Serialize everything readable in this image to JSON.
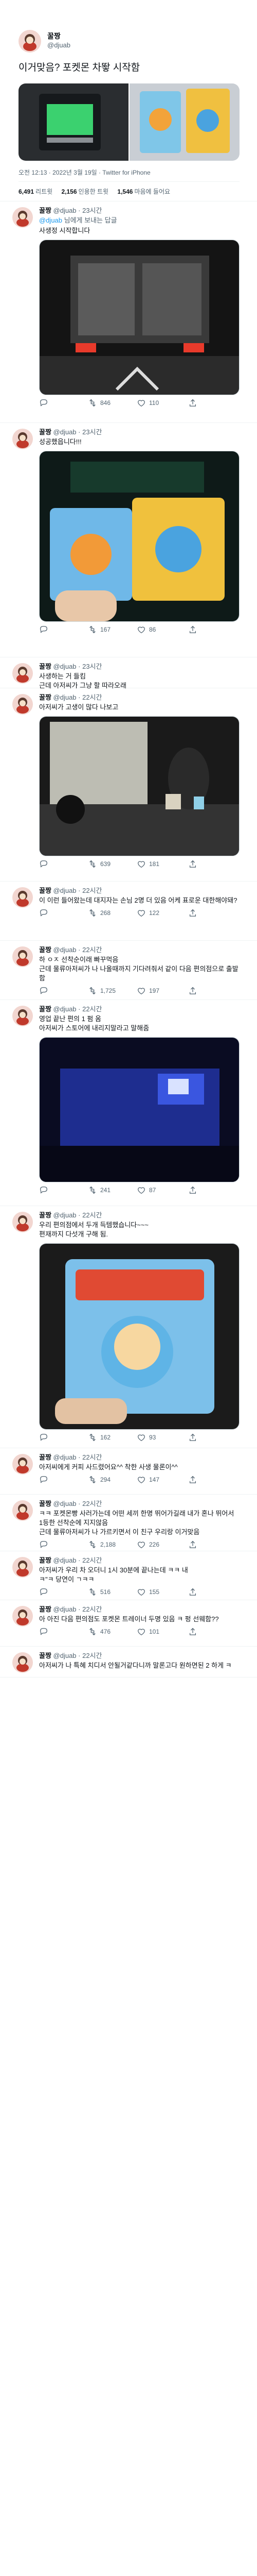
{
  "account": {
    "name": "꿀짱",
    "handle": "@djuab"
  },
  "reply_to": {
    "prefix": "",
    "mention": "@djuab",
    "suffix": " 님에게 보내는 답글"
  },
  "main_tweet": {
    "text": "이거맞음? 포켓몬 차뙇 시작함",
    "meta": "오전 12:13 · 2022년 3월 19일 · Twitter for iPhone",
    "stats": [
      {
        "value": "6,491",
        "label": "리트윗"
      },
      {
        "value": "2,156",
        "label": "인용한 트윗"
      },
      {
        "value": "1,546",
        "label": "마음에 들어요"
      }
    ]
  },
  "replies": [
    {
      "time": "· 23시간",
      "reply": true,
      "text": "사생정 시작합니다",
      "retweets": "846",
      "likes": "110"
    },
    {
      "time": "· 23시간",
      "reply": false,
      "text": "성공했읍니다!!!",
      "retweets": "167",
      "likes": "86"
    },
    {
      "time": "· 23시간",
      "reply": false,
      "text": "사생하는 거 들킴\n근데 아저씨가 그냥 할 따라오래",
      "retweets": "",
      "likes": ""
    },
    {
      "time": "· 22시간",
      "reply": false,
      "text": "아저씨가 고생이 많다 나보고",
      "retweets": "639",
      "likes": "181"
    },
    {
      "time": "· 22시간",
      "reply": false,
      "text": "이 이런 들어왔는데 대지자는 손님 2명 더 있음 어케 표로운 대한해야돼?",
      "retweets": "268",
      "likes": "122"
    },
    {
      "time": "· 22시간",
      "reply": false,
      "text": "하 ㅇㅈ 선착순이래 빠꾸먹음\n근데 물류아저씨가 나 나올때까지 기다려줘서 같이 다음 편의점으로 출발함",
      "retweets": "1,725",
      "likes": "197"
    },
    {
      "time": "· 22시간",
      "reply": false,
      "text": "영업 끝난 편의 1 펌 옴\n아저씨가 스토어에 내리지말라고 말해줌",
      "retweets": "241",
      "likes": "87"
    },
    {
      "time": "· 22시간",
      "reply": false,
      "text": "우리 편의점에서 두개 득템했습니다~~~\n편재까지 다섯개 구해 됨.",
      "retweets": "162",
      "likes": "93"
    },
    {
      "time": "· 22시간",
      "reply": false,
      "text": "아저씨에게 커피 사드렸어요^^ 착한 사생 물론이^^",
      "retweets": "294",
      "likes": "147"
    },
    {
      "time": "· 22시간",
      "reply": false,
      "text": "ㅋㅋ 포켓몬빵 사러가는데 어떤 세끼 한명 뛰어가길래 내가 혼나 뛰어서 1등한 선착순에 지지않음\n근데 물류아저씨가 나 가르키면서 이 친구 우리랑 이거맞음",
      "retweets": "2,188",
      "likes": "226"
    },
    {
      "time": "· 22시간",
      "reply": false,
      "text": "아저씨가 우리 차 오더니 1시 30분에 끝나는데 ㅋㅋ 내\nㅋ\"ㅋ 당연이 ㄱㅋㅋ",
      "retweets": "516",
      "likes": "155"
    },
    {
      "time": "· 22시간",
      "reply": false,
      "text": "아 아진 다음 편의점도 포켓몬 트레이너 두명 있음 ㅋ 펑 선웨함??",
      "retweets": "476",
      "likes": "101"
    },
    {
      "time": "· 22시간",
      "reply": false,
      "text": "아저씨가 나 특혜 치디서 안될거같다니까 말론고다 원하면된 2 하게 ㅋ",
      "retweets": "",
      "likes": ""
    }
  ]
}
